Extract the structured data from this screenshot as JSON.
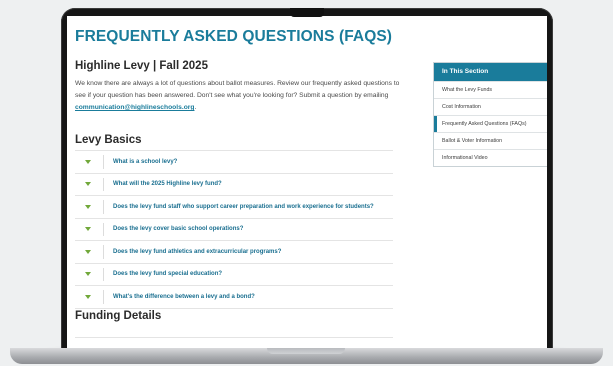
{
  "page": {
    "title": "FREQUENTLY ASKED QUESTIONS (FAQS)",
    "subtitle": "Highline Levy | Fall 2025",
    "intro_text": "We know there are always a lot of questions about ballot measures. Review our frequently asked questions to see if your question has been answered. Don't see what you're looking for? Submit a question by emailing ",
    "intro_email": "communication@highlineschools.org",
    "intro_end": "."
  },
  "levy_basics": {
    "heading": "Levy Basics",
    "questions": [
      "What is a school levy?",
      "What will the 2025 Highline levy fund?",
      "Does the levy fund staff who support career preparation and work experience for students?",
      "Does the levy cover basic school operations?",
      "Does the levy fund athletics and extracurricular programs?",
      "Does the levy fund special education?",
      "What's the difference between a levy and a bond?"
    ]
  },
  "funding_details": {
    "heading": "Funding Details"
  },
  "sidebar": {
    "heading": "In This Section",
    "items": [
      "What the Levy Funds",
      "Cost Information",
      "Frequently Asked Questions (FAQs)",
      "Ballot & Voter Information",
      "Informational Video"
    ]
  },
  "colors": {
    "brand": "#1a7c9b",
    "accent_green": "#71a83a"
  }
}
